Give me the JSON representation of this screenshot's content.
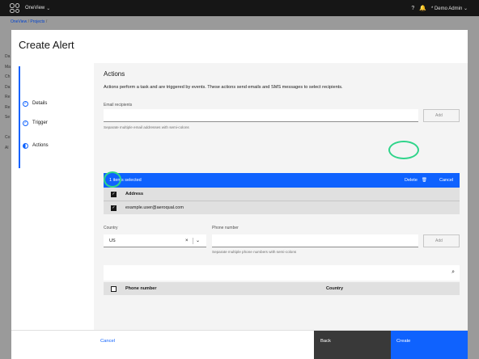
{
  "topbar": {
    "app_name": "OneView",
    "app_caret": "⌄",
    "help_icon": "?",
    "notifications_icon": "🔔",
    "user_name": "* Demo Admin ⌄"
  },
  "breadcrumb": {
    "items": [
      "OneView",
      "Projects"
    ],
    "separator": "/"
  },
  "background_sidebar": [
    "Da",
    "Ma",
    "Ch",
    "Da",
    "Re",
    "Re",
    "Se",
    "",
    "Co",
    "Al"
  ],
  "modal": {
    "title": "Create Alert",
    "steps": [
      {
        "label": "Details",
        "state": "complete"
      },
      {
        "label": "Trigger",
        "state": "complete"
      },
      {
        "label": "Actions",
        "state": "current"
      }
    ],
    "section": {
      "title": "Actions",
      "description": "Actions perform a task and are triggered by events. These actions send emails and SMS messages to select recipients."
    },
    "email": {
      "label": "Email recipients",
      "value": "",
      "placeholder": "",
      "helper": "Separate multiple email addresses with semi-colons",
      "add_label": "Add"
    },
    "batch": {
      "count_text": "1 items selected",
      "delete_label": "Delete",
      "delete_icon": "🗑",
      "cancel_label": "Cancel"
    },
    "email_table": {
      "header": "Address",
      "rows": [
        {
          "address": "example.user@aeroqual.com",
          "checked": true
        }
      ]
    },
    "country": {
      "label": "Country",
      "value": "US",
      "clear_icon": "×",
      "caret_icon": "⌄"
    },
    "phone": {
      "label": "Phone number",
      "value": "",
      "helper": "Separate multiple phone numbers with semi-colons",
      "add_label": "Add"
    },
    "phone_table": {
      "search_icon": "⌕",
      "headers": [
        "Phone number",
        "Country"
      ]
    },
    "footer": {
      "cancel_label": "Cancel",
      "back_label": "Back",
      "create_label": "Create"
    }
  },
  "colors": {
    "primary": "#0f62fe",
    "highlight_ring": "#2fd48a",
    "topbar": "#161616"
  }
}
